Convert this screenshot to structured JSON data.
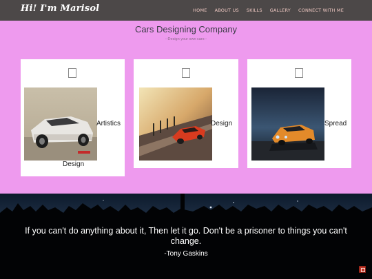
{
  "header": {
    "brand": "Hi! I'm Marisol",
    "nav": [
      "HOME",
      "ABOUT US",
      "SKILLS",
      "GALLERY",
      "CONNECT WITH ME"
    ]
  },
  "services": {
    "title": "Cars Designing Company",
    "subtitle": "--Design your own cars--",
    "cards": [
      {
        "label": "Artistics",
        "label2": "Design",
        "image": "white-muscle-car-photo"
      },
      {
        "label": "Design",
        "image": "red-sports-car-road-photo"
      },
      {
        "label": "Spread",
        "image": "orange-supercar-night-photo"
      }
    ]
  },
  "quote": {
    "text": "If you can't do anything about it, Then let it go. Don't be a prisoner to things you can't change.",
    "author": "-Tony Gaskins"
  },
  "colors": {
    "navbar": "#4c4848",
    "section_bg": "#ee9aee",
    "card_bg": "#ffffff",
    "quote_bg": "#000000",
    "scroll_top": "#c0392b"
  }
}
